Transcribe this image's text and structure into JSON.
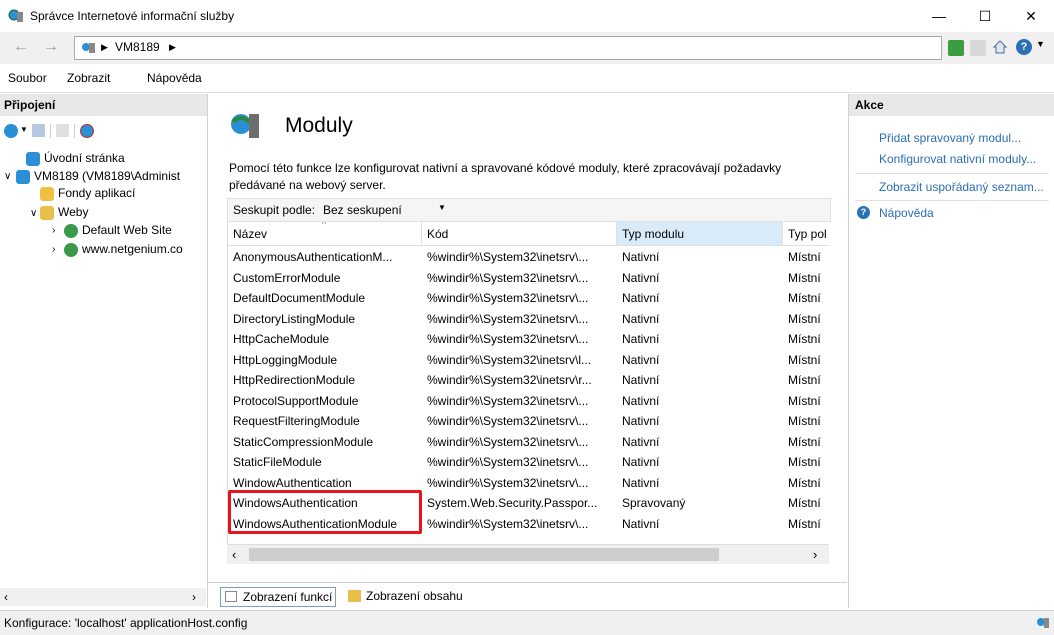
{
  "window": {
    "title": "Správce Internetové informační služby"
  },
  "address": {
    "crumbs": [
      "VM8189"
    ]
  },
  "menu": {
    "items": [
      "Soubor",
      "Zobrazit",
      "Nápověda"
    ]
  },
  "connections": {
    "header": "Připojení",
    "tree": [
      {
        "label": "Úvodní stránka",
        "level": 1,
        "icon": "iis-start-icon"
      },
      {
        "label": "VM8189 (VM8189\\Administ",
        "level": 0,
        "icon": "server-icon",
        "expanded": true
      },
      {
        "label": "Fondy aplikací",
        "level": 2,
        "icon": "app-pool-icon"
      },
      {
        "label": "Weby",
        "level": 1,
        "icon": "sites-folder-icon",
        "expanded": true
      },
      {
        "label": "Default Web Site",
        "level": 2,
        "icon": "globe-icon",
        "collapsed": true
      },
      {
        "label": "www.netgenium.co",
        "level": 2,
        "icon": "globe-icon",
        "collapsed": true
      }
    ]
  },
  "main": {
    "title": "Moduly",
    "description": "Pomocí této funkce lze konfigurovat nativní a spravované kódové moduly, které zpracovávají požadavky předávané na webový server.",
    "group_label": "Seskupit podle:",
    "group_value": "Bez seskupení",
    "columns": [
      "Název",
      "Kód",
      "Typ modulu",
      "Typ pol"
    ],
    "rows": [
      [
        "AnonymousAuthenticationM...",
        "%windir%\\System32\\inetsrv\\...",
        "Nativní",
        "Místní"
      ],
      [
        "CustomErrorModule",
        "%windir%\\System32\\inetsrv\\...",
        "Nativní",
        "Místní"
      ],
      [
        "DefaultDocumentModule",
        "%windir%\\System32\\inetsrv\\...",
        "Nativní",
        "Místní"
      ],
      [
        "DirectoryListingModule",
        "%windir%\\System32\\inetsrv\\...",
        "Nativní",
        "Místní"
      ],
      [
        "HttpCacheModule",
        "%windir%\\System32\\inetsrv\\...",
        "Nativní",
        "Místní"
      ],
      [
        "HttpLoggingModule",
        "%windir%\\System32\\inetsrv\\l...",
        "Nativní",
        "Místní"
      ],
      [
        "HttpRedirectionModule",
        "%windir%\\System32\\inetsrv\\r...",
        "Nativní",
        "Místní"
      ],
      [
        "ProtocolSupportModule",
        "%windir%\\System32\\inetsrv\\...",
        "Nativní",
        "Místní"
      ],
      [
        "RequestFilteringModule",
        "%windir%\\System32\\inetsrv\\...",
        "Nativní",
        "Místní"
      ],
      [
        "StaticCompressionModule",
        "%windir%\\System32\\inetsrv\\...",
        "Nativní",
        "Místní"
      ],
      [
        "StaticFileModule",
        "%windir%\\System32\\inetsrv\\...",
        "Nativní",
        "Místní"
      ],
      [
        "WindowAuthentication",
        "%windir%\\System32\\inetsrv\\...",
        "Nativní",
        "Místní"
      ],
      [
        "WindowsAuthentication",
        "System.Web.Security.Passpor...",
        "Spravovaný",
        "Místní"
      ],
      [
        "WindowsAuthenticationModule",
        "%windir%\\System32\\inetsrv\\...",
        "Nativní",
        "Místní"
      ]
    ],
    "highlighted_rows": [
      12,
      13
    ],
    "view_tabs": [
      "Zobrazení funkcí",
      "Zobrazení obsahu"
    ]
  },
  "actions": {
    "header": "Akce",
    "links": [
      "Přidat spravovaný modul...",
      "Konfigurovat nativní moduly...",
      "Zobrazit uspořádaný seznam..."
    ],
    "help": "Nápověda"
  },
  "status": {
    "text": "Konfigurace: 'localhost' applicationHost.config"
  },
  "colors": {
    "highlight_border": "#e8141b",
    "link": "#2b6fb6",
    "selected_header": "#d9ebf9"
  }
}
